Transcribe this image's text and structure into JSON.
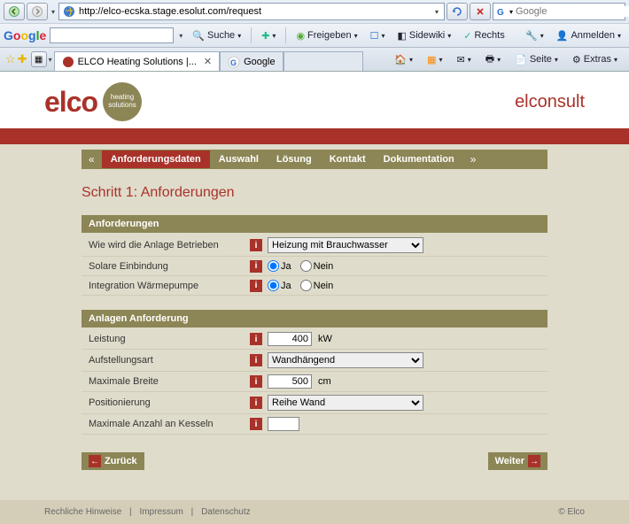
{
  "browser": {
    "url": "http://elco-ecska.stage.esolut.com/request",
    "search_placeholder": "Google",
    "google_toolbar": {
      "search": "Suche",
      "share": "Freigeben",
      "sidewiki": "Sidewiki",
      "rights": "Rechts",
      "login": "Anmelden"
    },
    "tabs": {
      "active": "ELCO Heating Solutions |...",
      "inactive": "Google"
    },
    "right_tools": {
      "page": "Seite",
      "extras": "Extras"
    }
  },
  "page": {
    "logo_text": "elco",
    "logo_badge": "heating solutions",
    "product": "elconsult",
    "nav": {
      "items": [
        "Anforderungsdaten",
        "Auswahl",
        "Lösung",
        "Kontakt",
        "Dokumentation"
      ]
    },
    "step_title": "Schritt 1: Anforderungen",
    "section1": {
      "title": "Anforderungen",
      "rows": [
        {
          "label": "Wie wird die Anlage Betrieben",
          "select_value": "Heizung mit Brauchwasser"
        },
        {
          "label": "Solare Einbindung",
          "yes": "Ja",
          "no": "Nein"
        },
        {
          "label": "Integration Wärmepumpe",
          "yes": "Ja",
          "no": "Nein"
        }
      ]
    },
    "section2": {
      "title": "Anlagen Anforderung",
      "rows": [
        {
          "label": "Leistung",
          "value": "400",
          "unit": "kW"
        },
        {
          "label": "Aufstellungsart",
          "select_value": "Wandhängend"
        },
        {
          "label": "Maximale Breite",
          "value": "500",
          "unit": "cm"
        },
        {
          "label": "Positionierung",
          "select_value": "Reihe Wand"
        },
        {
          "label": "Maximale Anzahl an Kesseln",
          "value": ""
        }
      ]
    },
    "buttons": {
      "back": "Zurück",
      "next": "Weiter"
    },
    "footer": {
      "legal": "Rechliche Hinweise",
      "imprint": "Impressum",
      "privacy": "Datenschutz",
      "copyright": "© Elco"
    }
  }
}
